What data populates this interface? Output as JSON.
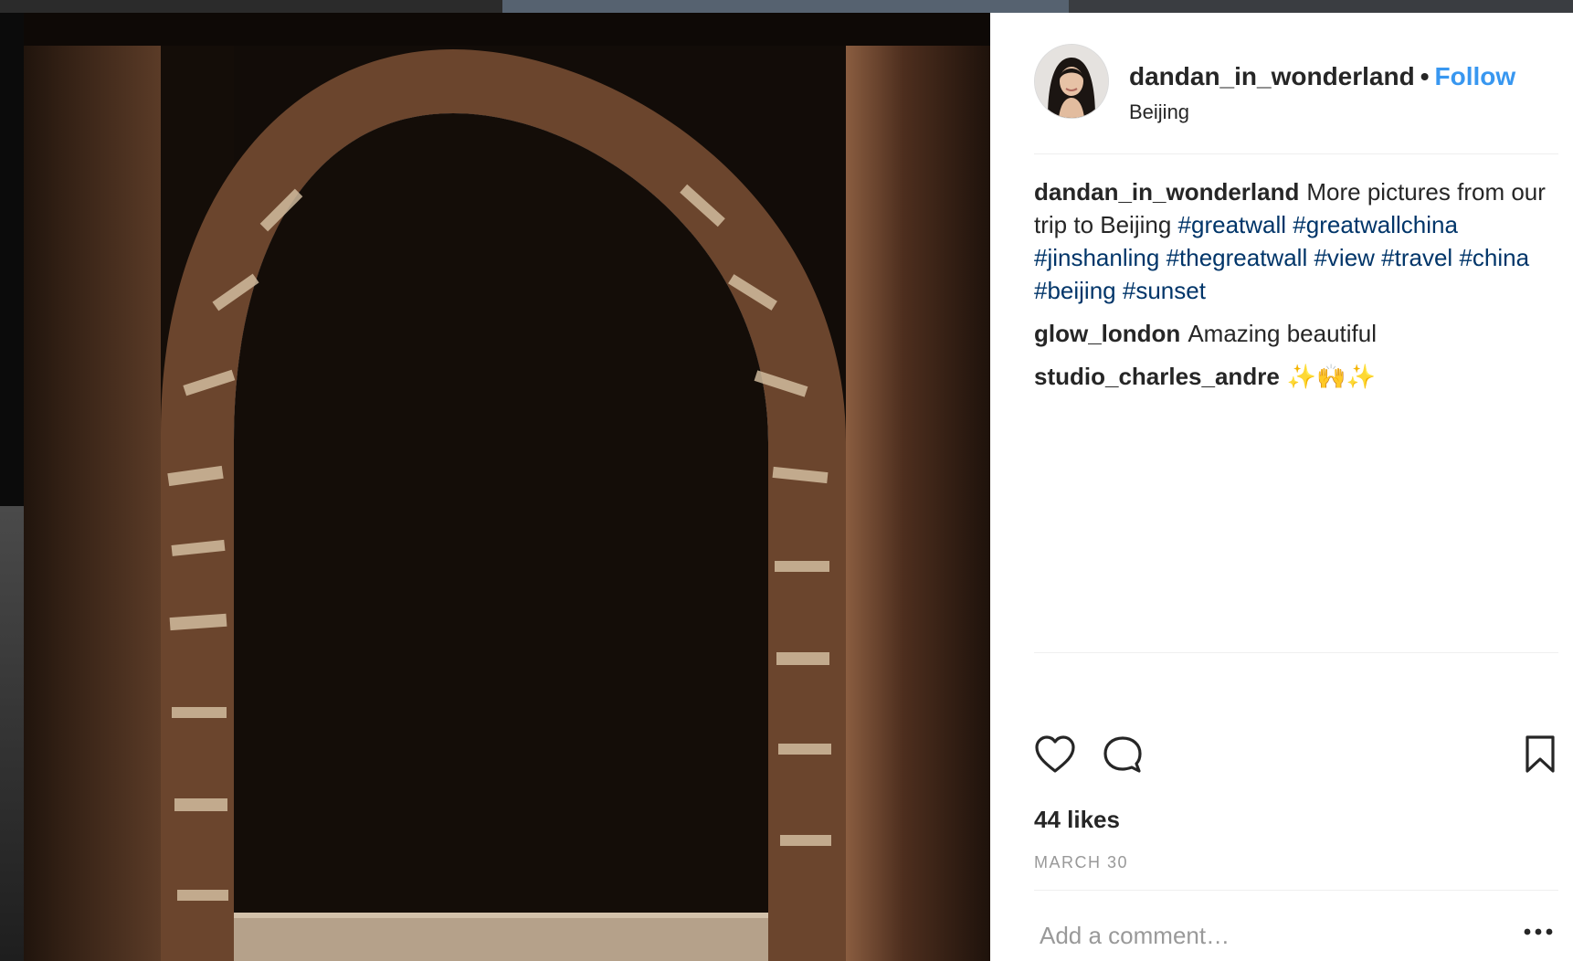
{
  "post": {
    "username": "dandan_in_wonderland",
    "separator": "•",
    "follow_label": "Follow",
    "location": "Beijing",
    "caption": {
      "username": "dandan_in_wonderland",
      "text": "More pictures from our trip to Beijing",
      "hashtags": [
        "#greatwall",
        "#greatwallchina",
        "#jinshanling",
        "#thegreatwall",
        "#view",
        "#travel",
        "#china",
        "#beijing",
        "#sunset"
      ]
    },
    "comments": [
      {
        "username": "glow_london",
        "text": "Amazing beautiful"
      },
      {
        "username": "studio_charles_andre",
        "text": "✨🙌✨"
      }
    ],
    "likes": "44 likes",
    "date": "MARCH 30",
    "comment_placeholder": "Add a comment…",
    "more_options": "•••"
  },
  "icons": {
    "like": "heart-icon",
    "comment": "comment-bubble-icon",
    "save": "bookmark-icon",
    "more": "more-options-icon"
  },
  "colors": {
    "follow": "#3897f0",
    "hashtag": "#003569",
    "text": "#262626",
    "muted": "#999999",
    "divider": "#efefef"
  }
}
